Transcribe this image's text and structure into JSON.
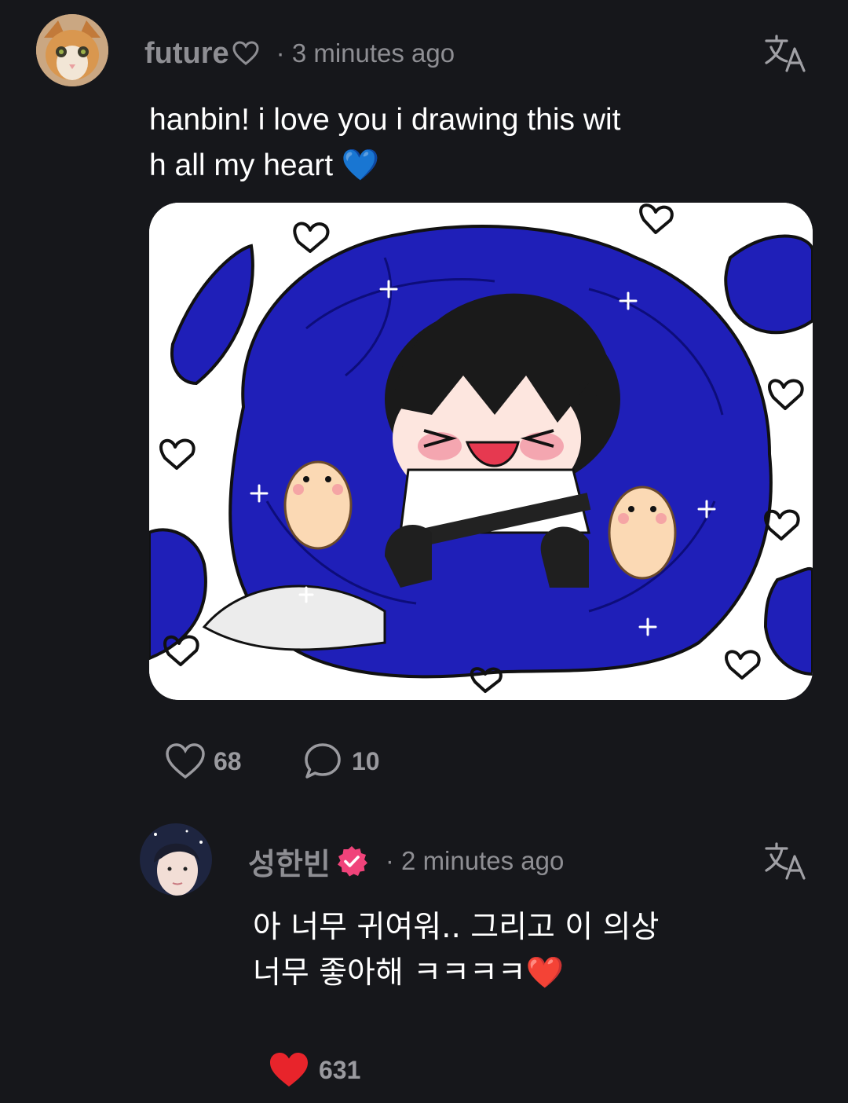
{
  "comment": {
    "author": "future",
    "author_suffix_icon": "heart-outline-icon",
    "time": "· 3 minutes ago",
    "text": "hanbin! i love you i drawing this wit\nh all my heart 💙",
    "attachment": "drawing",
    "likes": "68",
    "replies": "10"
  },
  "reply": {
    "author": "성한빈",
    "verified_badge": "verified-badge-icon",
    "time": "· 2 minutes ago",
    "text": "아 너무 귀여워.. 그리고 이 의상\n너무 좋아해 ㅋㅋㅋㅋ❤️",
    "likes": "631"
  },
  "colors": {
    "background": "#16171b",
    "muted_text": "#8e8e93",
    "heart_red": "#e8242b",
    "badge_pink": "#f0437a",
    "drawing_blue": "#1f1fb8"
  }
}
